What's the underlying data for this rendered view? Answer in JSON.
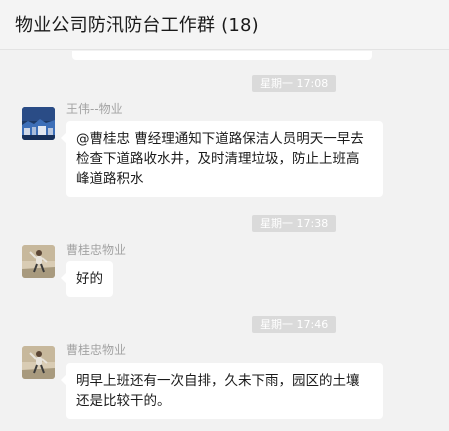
{
  "header": {
    "title": "物业公司防汛防台工作群 (18)"
  },
  "messages": [
    {
      "timestamp": "星期一 17:08",
      "sender": "王伟--物业",
      "avatar_icon": "city-landscape-avatar",
      "text_lines": [
        "@曹桂忠 曹经理通知下道路保洁人员明天一早去",
        "检查下道路收水井，及时清理垃圾，防止上班高",
        "峰道路积水"
      ]
    },
    {
      "timestamp": "星期一 17:38",
      "sender": "曹桂忠物业",
      "avatar_icon": "person-photo-avatar",
      "text_lines": [
        "好的"
      ]
    },
    {
      "timestamp": "星期一 17:46",
      "sender": "曹桂忠物业",
      "avatar_icon": "person-photo-avatar",
      "text_lines": [
        "明早上班还有一次自排，久未下雨，园区的土壤",
        "还是比较干的。"
      ]
    }
  ],
  "colors": {
    "background": "#f2f2f2",
    "bubble": "#ffffff",
    "timestamp_bg": "#dadada",
    "sender_text": "#a3a3a3"
  }
}
